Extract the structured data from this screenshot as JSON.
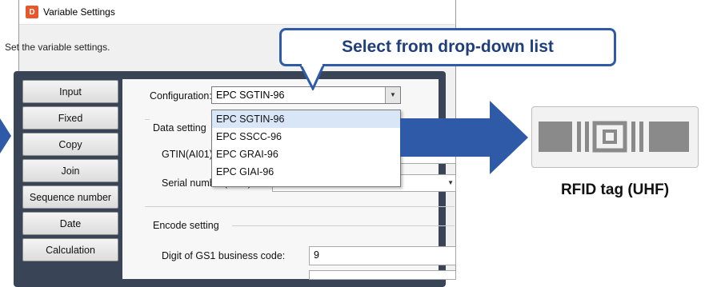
{
  "window": {
    "app_icon_text": "D",
    "title": "Variable Settings",
    "instruction": "Set the variable settings."
  },
  "tabs": [
    {
      "label": "Input"
    },
    {
      "label": "Fixed"
    },
    {
      "label": "Copy"
    },
    {
      "label": "Join"
    },
    {
      "label": "Sequence number"
    },
    {
      "label": "Date"
    },
    {
      "label": "Calculation"
    }
  ],
  "form": {
    "configuration_label": "Configuration:",
    "configuration_value": "EPC SGTIN-96",
    "dropdown_options": [
      "EPC SGTIN-96",
      "EPC SSCC-96",
      "EPC GRAI-96",
      "EPC GIAI-96"
    ],
    "data_setting_label": "Data setting",
    "gtin_label": "GTIN(AI01):",
    "serial_label": "Serial number(AI21):",
    "encode_setting_label": "Encode setting",
    "gs1_digit_label": "Digit of GS1 business code:",
    "gs1_digit_value": "9"
  },
  "callout": {
    "text": "Select from drop-down list"
  },
  "rfid": {
    "caption": "RFID tag (UHF)"
  },
  "colors": {
    "accent_blue": "#2e5aa8",
    "panel_dark": "#3a4457",
    "tag_gray": "#8a8a8a"
  }
}
